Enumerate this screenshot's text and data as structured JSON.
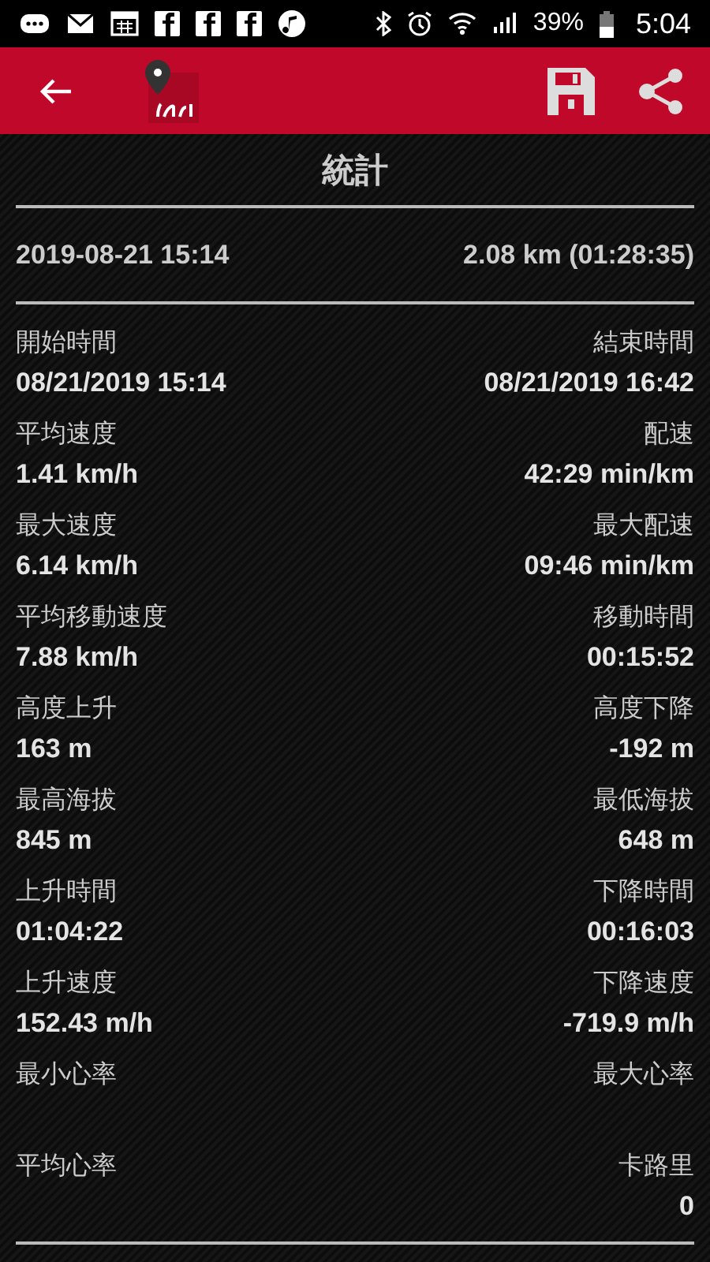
{
  "status_bar": {
    "battery": "39%",
    "time": "5:04"
  },
  "title": "統計",
  "summary": {
    "start": "2019-08-21 15:14",
    "distance": "2.08 km (01:28:35)"
  },
  "rows": [
    {
      "left": {
        "label": "開始時間",
        "value": "08/21/2019 15:14"
      },
      "right": {
        "label": "結束時間",
        "value": "08/21/2019 16:42"
      }
    },
    {
      "left": {
        "label": "平均速度",
        "value": "1.41 km/h"
      },
      "right": {
        "label": "配速",
        "value": "42:29 min/km"
      }
    },
    {
      "left": {
        "label": "最大速度",
        "value": "6.14 km/h"
      },
      "right": {
        "label": "最大配速",
        "value": "09:46 min/km"
      }
    },
    {
      "left": {
        "label": "平均移動速度",
        "value": "7.88 km/h"
      },
      "right": {
        "label": "移動時間",
        "value": "00:15:52"
      }
    },
    {
      "left": {
        "label": "高度上升",
        "value": "163 m"
      },
      "right": {
        "label": "高度下降",
        "value": "-192 m"
      }
    },
    {
      "left": {
        "label": "最高海拔",
        "value": "845 m"
      },
      "right": {
        "label": "最低海拔",
        "value": "648 m"
      }
    },
    {
      "left": {
        "label": "上升時間",
        "value": "01:04:22"
      },
      "right": {
        "label": "下降時間",
        "value": "00:16:03"
      }
    },
    {
      "left": {
        "label": "上升速度",
        "value": "152.43 m/h"
      },
      "right": {
        "label": "下降速度",
        "value": "-719.9 m/h"
      }
    },
    {
      "left": {
        "label": "最小心率"
      },
      "right": {
        "label": "最大心率"
      }
    },
    {
      "left": {
        "label": "平均心率"
      },
      "right": {
        "label": "卡路里",
        "value": "0"
      }
    }
  ]
}
